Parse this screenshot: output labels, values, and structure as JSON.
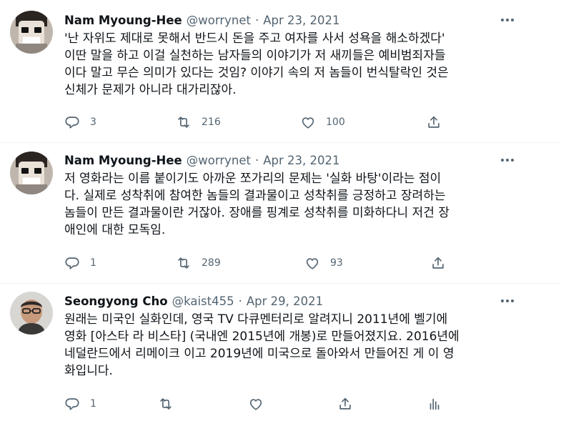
{
  "tweets": [
    {
      "name": "Nam Myoung-Hee",
      "handle": "@worrynet",
      "separator": "·",
      "date": "Apr 23, 2021",
      "lines": [
        "'난 자위도 제대로 못해서 반드시 돈을 주고 여자를 사서 성욕을 해소하겠다'",
        "이딴 말을 하고 이걸 실천하는 남자들의 이야기가 저 새끼들은 예비범죄자들",
        "이다 말고 무슨 의미가 있다는 것임? 이야기 속의 저 놈들이 번식탈락인 것은",
        "신체가 문제가 아니라 대가리잖아."
      ],
      "replies": "3",
      "retweets": "216",
      "likes": "100"
    },
    {
      "name": "Nam Myoung-Hee",
      "handle": "@worrynet",
      "separator": "·",
      "date": "Apr 23, 2021",
      "lines": [
        "저 영화라는 이름 붙이기도 아까운 쪼가리의 문제는 '실화 바탕'이라는 점이",
        "다. 실제로 성착취에 참여한 놈들의 결과물이고 성착취를 긍정하고 장려하는",
        "놈들이 만든 결과물이란 거잖아. 장애를 핑계로 성착취를 미화하다니 저건 장",
        "애인에 대한 모독임."
      ],
      "replies": "1",
      "retweets": "289",
      "likes": "93"
    },
    {
      "name": "Seongyong Cho",
      "handle": "@kaist455",
      "separator": "·",
      "date": "Apr 29, 2021",
      "lines": [
        "원래는 미국인 실화인데, 영국 TV 다큐멘터리로 알려지니 2011년에 벨기에",
        "영화 [아스타 라 비스타] (국내엔 2015년에 개봉)로 만들어졌지요. 2016년에",
        "네덜란드에서 리메이크 이고 2019년에 미국으로 돌아와서 만들어진 게 이 영",
        "화입니다."
      ],
      "replies": "1"
    }
  ],
  "colors": {
    "text": "#0f1419",
    "secondary": "#536471",
    "divider": "#eff3f4"
  },
  "icons": [
    "reply-icon",
    "retweet-icon",
    "like-icon",
    "share-icon",
    "analytics-icon",
    "more-icon"
  ]
}
